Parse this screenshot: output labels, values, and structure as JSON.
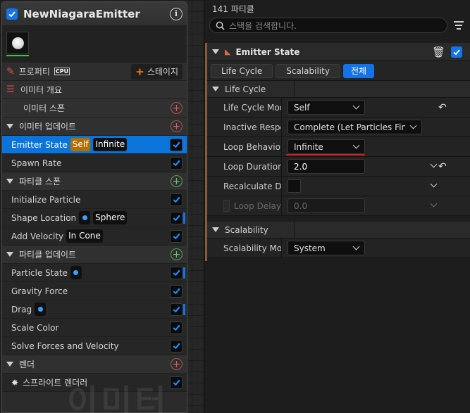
{
  "node": {
    "title": "NewNiagaraEmitter",
    "toolbar": {
      "properties_label": "프로퍼티",
      "cpu_label": "CPU",
      "stage_label": "스테이지"
    },
    "sections": {
      "summary": "이미터 개요",
      "spawn": "이미터 스폰",
      "update": "이미터 업데이트",
      "particle_spawn": "파티클 스폰",
      "particle_update": "파티클 업데이트",
      "render": "렌더"
    },
    "items": {
      "emitter_state": "Emitter State",
      "emitter_state_self": "Self",
      "emitter_state_infinite": "Infinite",
      "spawn_rate": "Spawn Rate",
      "initialize_particle": "Initialize Particle",
      "shape_location": "Shape Location",
      "shape_sphere": "Sphere",
      "add_velocity": "Add Velocity",
      "add_velocity_cone": "In Cone",
      "particle_state": "Particle State",
      "gravity_force": "Gravity Force",
      "drag": "Drag",
      "scale_color": "Scale Color",
      "solve_forces": "Solve Forces and Velocity",
      "sprite_renderer": "스프라이트 렌더러"
    },
    "watermark": "이미터"
  },
  "details": {
    "particle_count": "141 파티클",
    "search_placeholder": "스택을 검색합니다.",
    "module_title": "Emitter State",
    "tabs": [
      "Life Cycle",
      "Scalability",
      "전체"
    ],
    "life_cycle_header": "Life Cycle",
    "props": {
      "life_cycle_mode": {
        "name": "Life Cycle Mode",
        "value": "Self"
      },
      "inactive_response": {
        "name": "Inactive Response",
        "value": "Complete (Let Particles Finish)"
      },
      "loop_behavior": {
        "name": "Loop Behavior",
        "value": "Infinite"
      },
      "loop_duration": {
        "name": "Loop Duration",
        "value": "2.0"
      },
      "recalculate_duration": {
        "name": "Recalculate Duration"
      },
      "loop_delay": {
        "name": "Loop Delay",
        "value": "0.0"
      }
    },
    "scalability_header": "Scalability",
    "scalability_mode": {
      "name": "Scalability Mode",
      "value": "System"
    }
  },
  "colors": {
    "accent": "#1473e6",
    "selected_row": "#0a74da",
    "self_badge": "#b26f00",
    "module_accent": "#8a5a3a"
  }
}
